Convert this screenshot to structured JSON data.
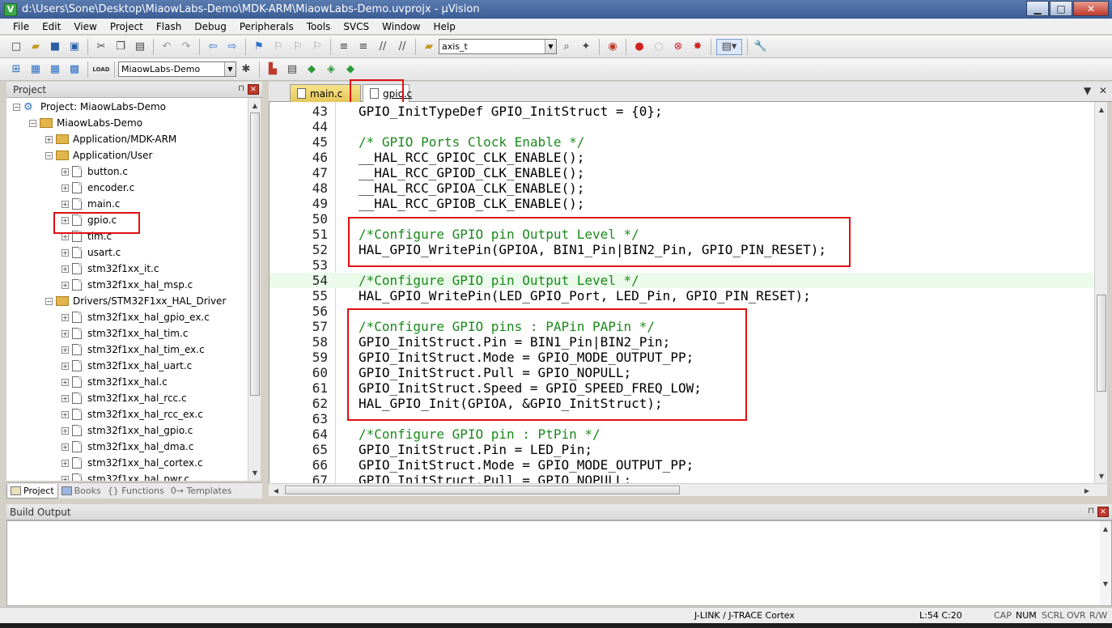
{
  "window": {
    "title": "d:\\Users\\Sone\\Desktop\\MiaowLabs-Demo\\MDK-ARM\\MiaowLabs-Demo.uvprojx - µVision",
    "icon_letter": "V",
    "minimize": "▁",
    "maximize": "□",
    "close": "✕"
  },
  "menu": [
    "File",
    "Edit",
    "View",
    "Project",
    "Flash",
    "Debug",
    "Peripherals",
    "Tools",
    "SVCS",
    "Window",
    "Help"
  ],
  "toolbar1": {
    "find_combo": "axis_t"
  },
  "toolbar2": {
    "target_combo": "MiaowLabs-Demo",
    "load_label": "LOAD"
  },
  "project_panel": {
    "title": "Project",
    "pin": "⊓",
    "close": "✕",
    "root": "Project: MiaowLabs-Demo",
    "target": "MiaowLabs-Demo",
    "groups": [
      {
        "label": "Application/MDK-ARM",
        "expanded": false
      },
      {
        "label": "Application/User",
        "expanded": true,
        "files": [
          "button.c",
          "encoder.c",
          "main.c",
          "gpio.c",
          "tim.c",
          "usart.c",
          "stm32f1xx_it.c",
          "stm32f1xx_hal_msp.c"
        ]
      },
      {
        "label": "Drivers/STM32F1xx_HAL_Driver",
        "expanded": true,
        "files": [
          "stm32f1xx_hal_gpio_ex.c",
          "stm32f1xx_hal_tim.c",
          "stm32f1xx_hal_tim_ex.c",
          "stm32f1xx_hal_uart.c",
          "stm32f1xx_hal.c",
          "stm32f1xx_hal_rcc.c",
          "stm32f1xx_hal_rcc_ex.c",
          "stm32f1xx_hal_gpio.c",
          "stm32f1xx_hal_dma.c",
          "stm32f1xx_hal_cortex.c",
          "stm32f1xx_hal_pwr.c"
        ]
      }
    ],
    "tabs": [
      "Project",
      "Books",
      "{} Functions",
      "0→ Templates"
    ]
  },
  "editor": {
    "tabs": [
      {
        "label": "main.c",
        "active": false
      },
      {
        "label": "gpio.c",
        "active": true
      }
    ],
    "tab_menu": "▼",
    "tab_close": "✕",
    "lines": [
      {
        "n": "43",
        "text": "GPIO_InitTypeDef GPIO_InitStruct = {0};",
        "comment": false
      },
      {
        "n": "44",
        "text": "",
        "comment": false
      },
      {
        "n": "45",
        "text": "/* GPIO Ports Clock Enable */",
        "comment": true
      },
      {
        "n": "46",
        "text": "__HAL_RCC_GPIOC_CLK_ENABLE();",
        "comment": false
      },
      {
        "n": "47",
        "text": "__HAL_RCC_GPIOD_CLK_ENABLE();",
        "comment": false
      },
      {
        "n": "48",
        "text": "__HAL_RCC_GPIOA_CLK_ENABLE();",
        "comment": false
      },
      {
        "n": "49",
        "text": "__HAL_RCC_GPIOB_CLK_ENABLE();",
        "comment": false
      },
      {
        "n": "50",
        "text": "",
        "comment": false
      },
      {
        "n": "51",
        "text": "/*Configure GPIO pin Output Level */",
        "comment": true
      },
      {
        "n": "52",
        "text": "HAL_GPIO_WritePin(GPIOA, BIN1_Pin|BIN2_Pin, GPIO_PIN_RESET);",
        "comment": false
      },
      {
        "n": "53",
        "text": "",
        "comment": false
      },
      {
        "n": "54",
        "text": "/*Configure GPIO pin Output Level */",
        "comment": true,
        "current": true
      },
      {
        "n": "55",
        "text": "HAL_GPIO_WritePin(LED_GPIO_Port, LED_Pin, GPIO_PIN_RESET);",
        "comment": false
      },
      {
        "n": "56",
        "text": "",
        "comment": false
      },
      {
        "n": "57",
        "text": "/*Configure GPIO pins : PAPin PAPin */",
        "comment": true
      },
      {
        "n": "58",
        "text": "GPIO_InitStruct.Pin = BIN1_Pin|BIN2_Pin;",
        "comment": false
      },
      {
        "n": "59",
        "text": "GPIO_InitStruct.Mode = GPIO_MODE_OUTPUT_PP;",
        "comment": false
      },
      {
        "n": "60",
        "text": "GPIO_InitStruct.Pull = GPIO_NOPULL;",
        "comment": false
      },
      {
        "n": "61",
        "text": "GPIO_InitStruct.Speed = GPIO_SPEED_FREQ_LOW;",
        "comment": false
      },
      {
        "n": "62",
        "text": "HAL_GPIO_Init(GPIOA, &GPIO_InitStruct);",
        "comment": false
      },
      {
        "n": "63",
        "text": "",
        "comment": false
      },
      {
        "n": "64",
        "text": "/*Configure GPIO pin : PtPin */",
        "comment": true
      },
      {
        "n": "65",
        "text": "GPIO_InitStruct.Pin = LED_Pin;",
        "comment": false
      },
      {
        "n": "66",
        "text": "GPIO_InitStruct.Mode = GPIO_MODE_OUTPUT_PP;",
        "comment": false
      },
      {
        "n": "67",
        "text": "GPIO_InitStruct.Pull = GPIO_NOPULL;",
        "comment": false
      }
    ]
  },
  "build_output": {
    "title": "Build Output",
    "pin": "⊓",
    "close": "✕"
  },
  "status": {
    "debugger": "J-LINK / J-TRACE Cortex",
    "position": "L:54 C:20",
    "caps": "CAP",
    "num": "NUM",
    "scrl": "SCRL",
    "ovr": "OVR",
    "rw": "R/W"
  },
  "colors": {
    "highlight_box": "#e01010",
    "comment": "#1a8a1a",
    "current_line": "#ebfaeb",
    "active_tab_bg": "#ffffff",
    "inactive_tab_bg": "#e5c75a"
  }
}
